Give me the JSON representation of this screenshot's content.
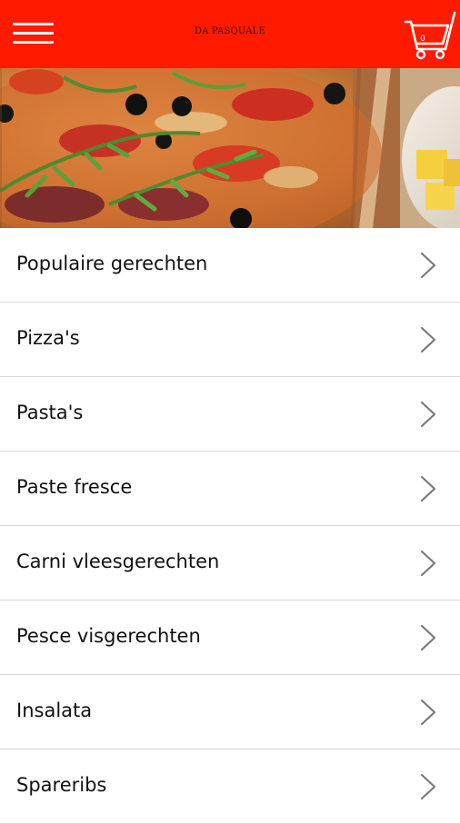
{
  "header": {
    "brand": "DA PASQUALE",
    "cart_count": "0",
    "background_color": "#ff1a00",
    "menu_icon": "hamburger-icon",
    "cart_icon": "shopping-cart-icon"
  },
  "hero": {
    "image": "pizza-photo"
  },
  "menu": {
    "items": [
      {
        "label": "Populaire gerechten"
      },
      {
        "label": "Pizza's"
      },
      {
        "label": "Pasta's"
      },
      {
        "label": "Paste fresce"
      },
      {
        "label": "Carni vleesgerechten"
      },
      {
        "label": "Pesce visgerechten"
      },
      {
        "label": "Insalata"
      },
      {
        "label": "Spareribs"
      }
    ],
    "chevron_icon": "chevron-right-icon"
  }
}
